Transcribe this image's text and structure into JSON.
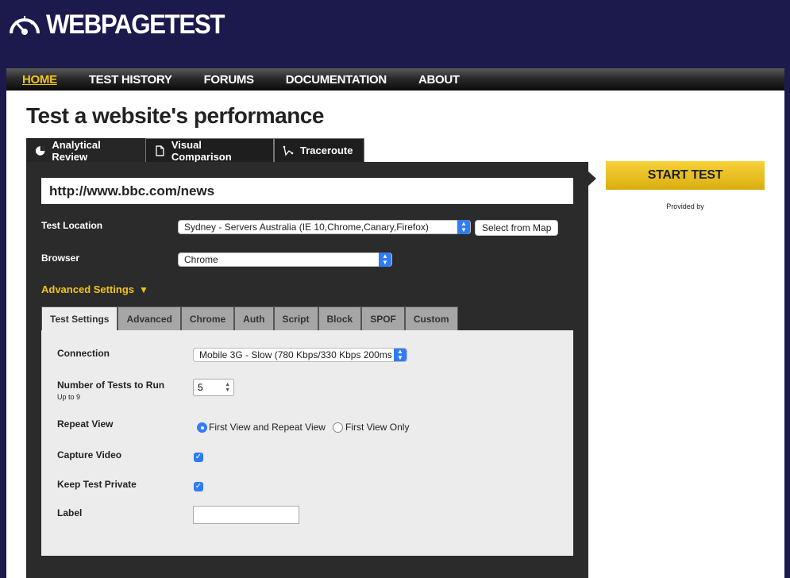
{
  "brand": {
    "logo_text_bold": "WEB",
    "logo_text": "PAGETEST"
  },
  "nav": [
    {
      "label": "HOME",
      "active": true
    },
    {
      "label": "TEST HISTORY",
      "active": false
    },
    {
      "label": "FORUMS",
      "active": false
    },
    {
      "label": "DOCUMENTATION",
      "active": false
    },
    {
      "label": "ABOUT",
      "active": false
    }
  ],
  "page": {
    "title": "Test a website's performance"
  },
  "tabs": [
    {
      "label": "Analytical Review",
      "icon": "pie-chart-icon",
      "active": true
    },
    {
      "label": "Visual Comparison",
      "icon": "document-icon",
      "active": false
    },
    {
      "label": "Traceroute",
      "icon": "trace-path-icon",
      "active": false
    }
  ],
  "form": {
    "url": "http://www.bbc.com/news",
    "test_location_label": "Test Location",
    "test_location_value": "Sydney - Servers Australia (IE 10,Chrome,Canary,Firefox)",
    "select_from_map": "Select from Map",
    "browser_label": "Browser",
    "browser_value": "Chrome",
    "advanced_settings": "Advanced Settings"
  },
  "subtabs": [
    {
      "label": "Test Settings",
      "active": true
    },
    {
      "label": "Advanced",
      "active": false
    },
    {
      "label": "Chrome",
      "active": false
    },
    {
      "label": "Auth",
      "active": false
    },
    {
      "label": "Script",
      "active": false
    },
    {
      "label": "Block",
      "active": false
    },
    {
      "label": "SPOF",
      "active": false
    },
    {
      "label": "Custom",
      "active": false
    }
  ],
  "settings": {
    "connection_label": "Connection",
    "connection_value": "Mobile 3G - Slow (780 Kbps/330 Kbps 200ms",
    "num_tests_label": "Number of Tests to Run",
    "num_tests_hint": "Up to 9",
    "num_tests_value": "5",
    "repeat_view_label": "Repeat View",
    "repeat_option_1": "First View and Repeat View",
    "repeat_option_2": "First View Only",
    "capture_video_label": "Capture Video",
    "keep_private_label": "Keep Test Private",
    "label_label": "Label"
  },
  "actions": {
    "start_test": "START TEST",
    "provided_by": "Provided by"
  },
  "colors": {
    "header_bg": "#1c1a4d",
    "accent": "#f3c516",
    "panel_bg": "#2b2b2b",
    "subpanel_bg": "#ececec",
    "checkbox": "#2f7cf6"
  }
}
